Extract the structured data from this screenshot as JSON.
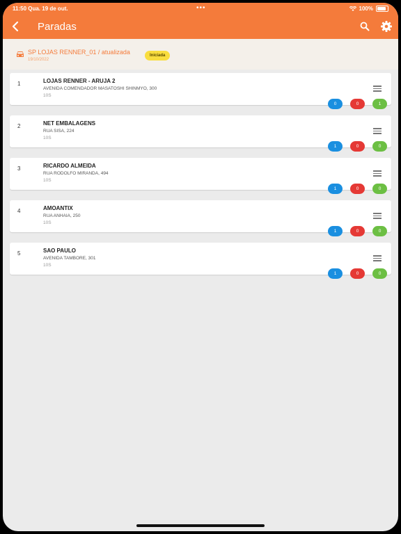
{
  "status_bar": {
    "time_date": "11:50  Qua. 19 de out.",
    "battery": "100%"
  },
  "header": {
    "title": "Paradas"
  },
  "route": {
    "name": "SP LOJAS RENNER_01 / atualizada",
    "date": "19/10/2022",
    "status": "Iniciada"
  },
  "colors": {
    "accent": "#f47b3b",
    "blue": "#1a8fe0",
    "red": "#e53935",
    "green": "#6cbf43",
    "badge": "#f9dd3e"
  },
  "stops": [
    {
      "number": "1",
      "name": "LOJAS RENNER - ARUJA 2",
      "address": "AVENIDA COMENDADOR MASATOSHI SHINMYO, 300",
      "code": "10S",
      "blue": "0",
      "red": "0",
      "green": "1"
    },
    {
      "number": "2",
      "name": "NET EMBALAGENS",
      "address": "RUA SISA, 224",
      "code": "10S",
      "blue": "1",
      "red": "0",
      "green": "0"
    },
    {
      "number": "3",
      "name": "RICARDO ALMEIDA",
      "address": "RUA RODOLFO MIRANDA, 494",
      "code": "10S",
      "blue": "1",
      "red": "0",
      "green": "0"
    },
    {
      "number": "4",
      "name": "AMOANTIX",
      "address": "RUA ANHAIA, 250",
      "code": "10S",
      "blue": "1",
      "red": "0",
      "green": "0"
    },
    {
      "number": "5",
      "name": "SAO PAULO",
      "address": "AVENIDA TAMBORE, 301",
      "code": "10S",
      "blue": "1",
      "red": "0",
      "green": "0"
    }
  ]
}
